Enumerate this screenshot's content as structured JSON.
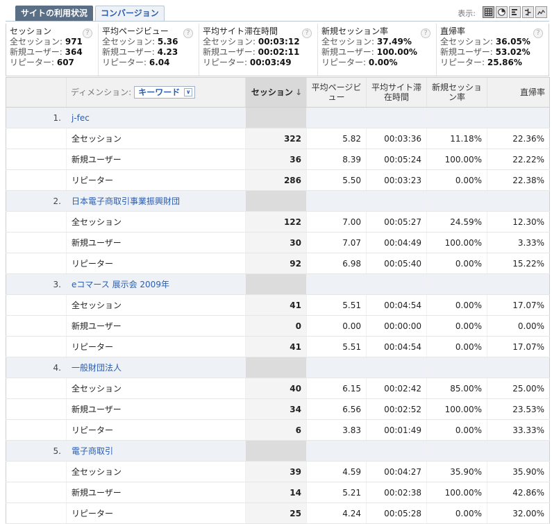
{
  "tabs": [
    {
      "label": "サイトの利用状況"
    },
    {
      "label": "コンバージョン"
    }
  ],
  "view": {
    "label": "表示:"
  },
  "summary": [
    {
      "title": "セッション",
      "lines": [
        {
          "label": "全セッション: ",
          "value": "971"
        },
        {
          "label": "新規ユーザー: ",
          "value": "364"
        },
        {
          "label": "リピーター: ",
          "value": "607"
        }
      ]
    },
    {
      "title": "平均ページビュー",
      "lines": [
        {
          "label": "全セッション: ",
          "value": "5.36"
        },
        {
          "label": "新規ユーザー: ",
          "value": "4.23"
        },
        {
          "label": "リピーター: ",
          "value": "6.04"
        }
      ]
    },
    {
      "title": "平均サイト滞在時間",
      "lines": [
        {
          "label": "全セッション: ",
          "value": "00:03:12"
        },
        {
          "label": "新規ユーザー: ",
          "value": "00:02:11"
        },
        {
          "label": "リピーター: ",
          "value": "00:03:49"
        }
      ]
    },
    {
      "title": "新規セッション率",
      "lines": [
        {
          "label": "全セッション: ",
          "value": "37.49%"
        },
        {
          "label": "新規ユーザー: ",
          "value": "100.00%"
        },
        {
          "label": "リピーター: ",
          "value": "0.00%"
        }
      ]
    },
    {
      "title": "直帰率",
      "lines": [
        {
          "label": "全セッション: ",
          "value": "36.05%"
        },
        {
          "label": "新規ユーザー: ",
          "value": "53.02%"
        },
        {
          "label": "リピーター: ",
          "value": "25.86%"
        }
      ]
    }
  ],
  "help_glyph": "?",
  "table": {
    "dimension_label": "ディメンション:",
    "dimension_value": "キーワード",
    "dimension_chevron": "∨",
    "columns": {
      "sessions": "セッション",
      "pageviews": "平均ページビュー",
      "duration": "平均サイト滞在時間",
      "new_rate": "新規セッション率",
      "bounce": "直帰率"
    },
    "sort_arrow": "↓",
    "groups": [
      {
        "index": "1.",
        "keyword": "j-fec",
        "rows": [
          {
            "label": "全セッション",
            "sessions": "322",
            "pageviews": "5.82",
            "duration": "00:03:36",
            "new_rate": "11.18%",
            "bounce": "22.36%"
          },
          {
            "label": "新規ユーザー",
            "sessions": "36",
            "pageviews": "8.39",
            "duration": "00:05:24",
            "new_rate": "100.00%",
            "bounce": "22.22%"
          },
          {
            "label": "リピーター",
            "sessions": "286",
            "pageviews": "5.50",
            "duration": "00:03:23",
            "new_rate": "0.00%",
            "bounce": "22.38%"
          }
        ]
      },
      {
        "index": "2.",
        "keyword": "日本電子商取引事業振興財団",
        "rows": [
          {
            "label": "全セッション",
            "sessions": "122",
            "pageviews": "7.00",
            "duration": "00:05:27",
            "new_rate": "24.59%",
            "bounce": "12.30%"
          },
          {
            "label": "新規ユーザー",
            "sessions": "30",
            "pageviews": "7.07",
            "duration": "00:04:49",
            "new_rate": "100.00%",
            "bounce": "3.33%"
          },
          {
            "label": "リピーター",
            "sessions": "92",
            "pageviews": "6.98",
            "duration": "00:05:40",
            "new_rate": "0.00%",
            "bounce": "15.22%"
          }
        ]
      },
      {
        "index": "3.",
        "keyword": "eコマース 展示会 2009年",
        "rows": [
          {
            "label": "全セッション",
            "sessions": "41",
            "pageviews": "5.51",
            "duration": "00:04:54",
            "new_rate": "0.00%",
            "bounce": "17.07%"
          },
          {
            "label": "新規ユーザー",
            "sessions": "0",
            "pageviews": "0.00",
            "duration": "00:00:00",
            "new_rate": "0.00%",
            "bounce": "0.00%"
          },
          {
            "label": "リピーター",
            "sessions": "41",
            "pageviews": "5.51",
            "duration": "00:04:54",
            "new_rate": "0.00%",
            "bounce": "17.07%"
          }
        ]
      },
      {
        "index": "4.",
        "keyword": "一般財団法人",
        "rows": [
          {
            "label": "全セッション",
            "sessions": "40",
            "pageviews": "6.15",
            "duration": "00:02:42",
            "new_rate": "85.00%",
            "bounce": "25.00%"
          },
          {
            "label": "新規ユーザー",
            "sessions": "34",
            "pageviews": "6.56",
            "duration": "00:02:52",
            "new_rate": "100.00%",
            "bounce": "23.53%"
          },
          {
            "label": "リピーター",
            "sessions": "6",
            "pageviews": "3.83",
            "duration": "00:01:49",
            "new_rate": "0.00%",
            "bounce": "33.33%"
          }
        ]
      },
      {
        "index": "5.",
        "keyword": "電子商取引",
        "rows": [
          {
            "label": "全セッション",
            "sessions": "39",
            "pageviews": "4.59",
            "duration": "00:04:27",
            "new_rate": "35.90%",
            "bounce": "35.90%"
          },
          {
            "label": "新規ユーザー",
            "sessions": "14",
            "pageviews": "5.21",
            "duration": "00:02:38",
            "new_rate": "100.00%",
            "bounce": "42.86%"
          },
          {
            "label": "リピーター",
            "sessions": "25",
            "pageviews": "4.24",
            "duration": "00:05:28",
            "new_rate": "0.00%",
            "bounce": "32.00%"
          }
        ]
      }
    ]
  }
}
